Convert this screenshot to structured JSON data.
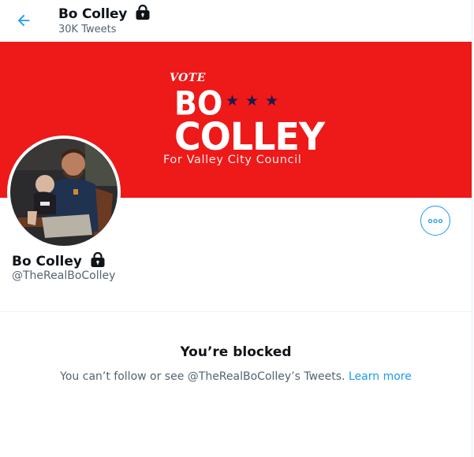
{
  "header": {
    "name": "Bo Colley",
    "tweet_count": "30K Tweets"
  },
  "banner": {
    "vote": "VOTE",
    "first_name": "BO",
    "stars": "★★★",
    "last_name": "COLLEY",
    "tagline": "For Valley City Council"
  },
  "profile": {
    "name": "Bo Colley",
    "handle": "@TheRealBoColley"
  },
  "blocked": {
    "title": "You’re blocked",
    "message": "You can’t follow or see @TheRealBoColley’s Tweets. ",
    "link": "Learn more"
  },
  "colors": {
    "accent": "#1d9bf0",
    "banner": "#ee1919",
    "secondary_text": "#536471"
  },
  "icons": {
    "back": "arrow-left-icon",
    "lock": "lock-icon",
    "more": "more-dots-icon"
  }
}
